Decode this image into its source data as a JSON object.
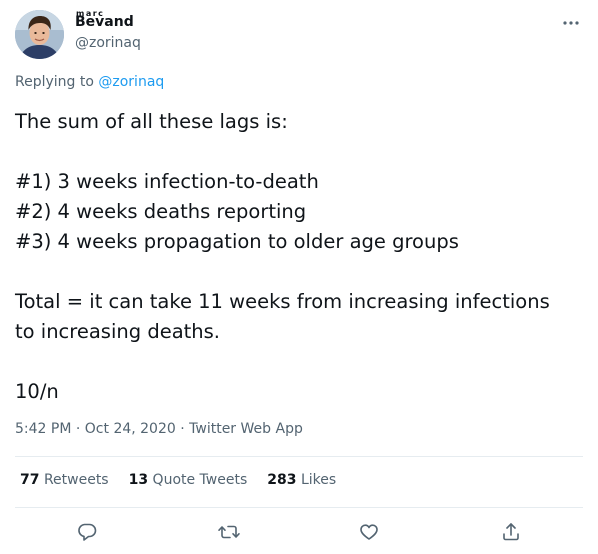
{
  "author": {
    "display_name": "Bevand",
    "display_name_accents": "marc",
    "handle": "@zorinaq"
  },
  "replying": {
    "prefix": "Replying to ",
    "to": "@zorinaq"
  },
  "body_lines": [
    "The sum of all these lags is:",
    "",
    "#1) 3 weeks infection-to-death",
    "#2) 4 weeks deaths reporting",
    "#3) 4 weeks propagation to older age groups",
    "",
    "Total = it can take 11 weeks from increasing infections",
    "to increasing deaths.",
    "",
    "10/n"
  ],
  "meta": {
    "time": "5:42 PM",
    "date": "Oct 24, 2020",
    "source": "Twitter Web App",
    "separator": " · "
  },
  "stats": {
    "retweets_count": "77",
    "retweets_label": "Retweets",
    "quotes_count": "13",
    "quotes_label": "Quote Tweets",
    "likes_count": "283",
    "likes_label": "Likes"
  },
  "icons": {
    "more": "more-horizontal-icon",
    "reply": "reply-icon",
    "retweet": "retweet-icon",
    "like": "heart-icon",
    "share": "share-icon"
  },
  "colors": {
    "link": "#1d9bf0",
    "secondary_text": "#536471",
    "primary_text": "#0f1419",
    "divider": "#e6ecf0"
  }
}
